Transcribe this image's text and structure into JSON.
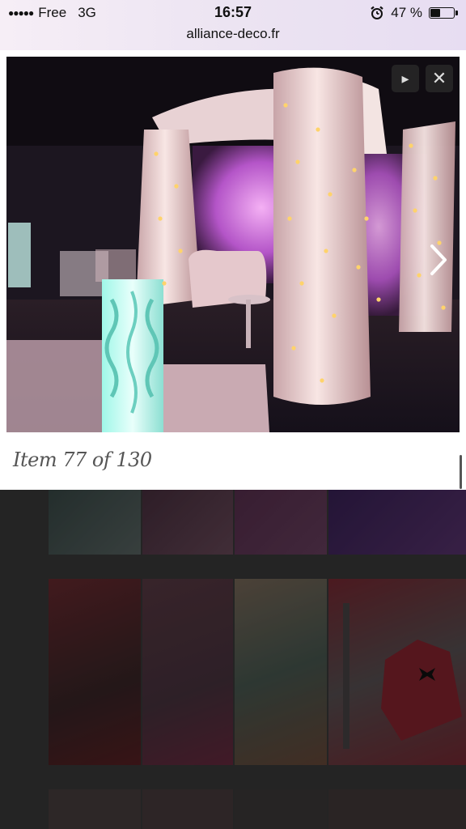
{
  "status_bar": {
    "carrier": "Free",
    "network": "3G",
    "time": "16:57",
    "battery_percent": "47 %",
    "battery_level": 0.47,
    "url": "alliance-deco.fr"
  },
  "lightbox": {
    "caption": "Item 77 of 130",
    "play_icon": "play-icon",
    "close_icon": "close-icon",
    "next_icon": "chevron-right-icon"
  },
  "colors": {
    "status_bg": "#efe7f3",
    "caption_text": "#555555",
    "backdrop": "#3a3a3a"
  }
}
